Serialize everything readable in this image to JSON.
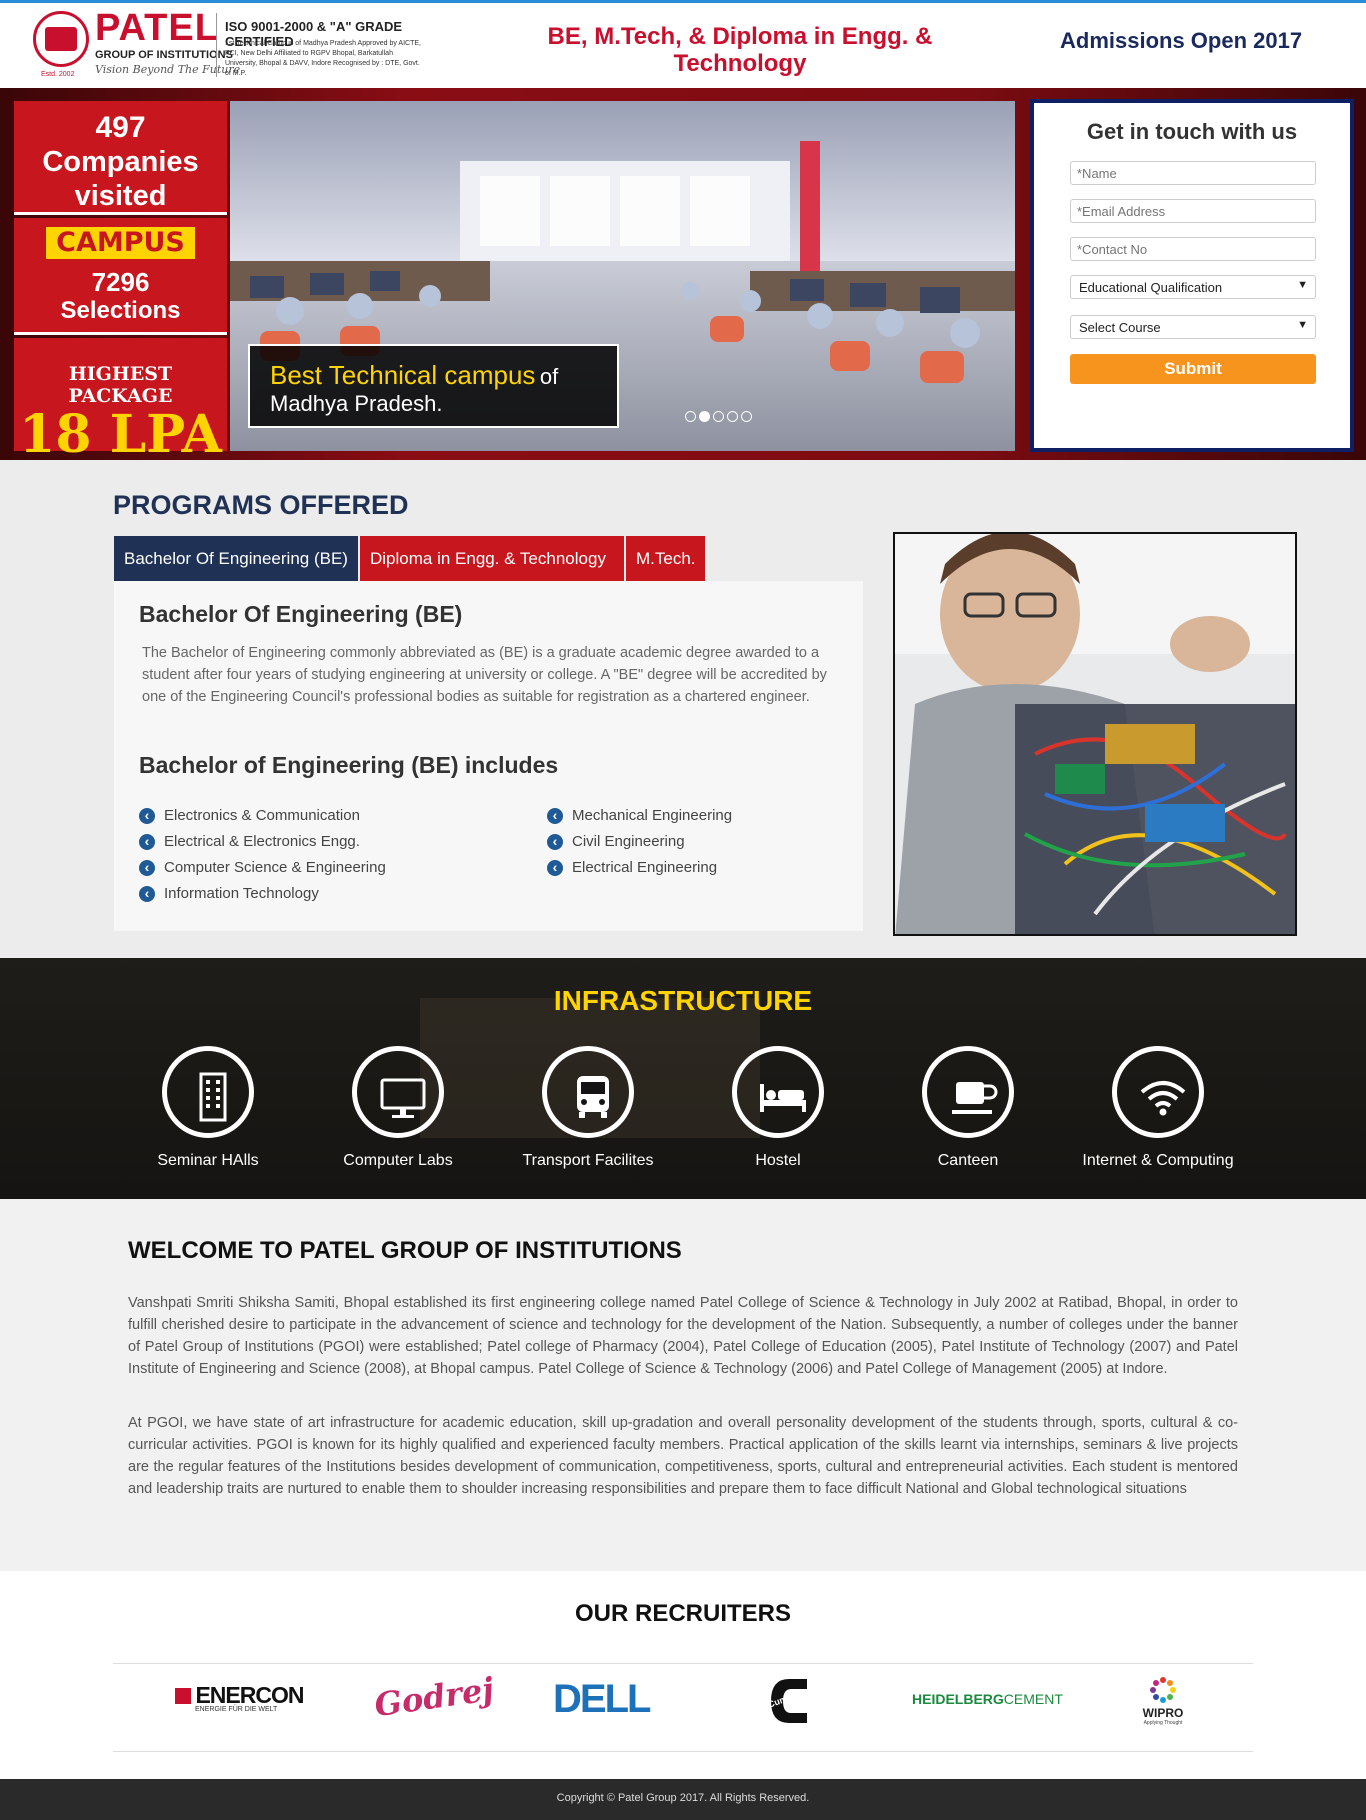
{
  "header": {
    "logo_name": "PATEL",
    "logo_group": "GROUP OF INSTITUTIONS",
    "logo_tagline": "Vision Beyond The Future",
    "logo_estd": "Estd. 2002",
    "iso_title": "ISO 9001-2000 & \"A\" GRADE CERTIFIED",
    "iso_text": "1st Technical Campus of Madhya Pradesh Approved by AICTE, PCI, New Delhi Affiliated to RGPV Bhopal, Barkatullah University, Bhopal & DAVV, Indore Recognised by : DTE, Govt. of M.P.",
    "programs_heading": "BE, M.Tech, & Diploma in Engg. & Technology",
    "admission": "Admissions Open 2017"
  },
  "hero": {
    "stat1_number": "497",
    "stat1_label_a": "Companies",
    "stat1_label_b": "visited",
    "campus_badge": "CAMPUS",
    "stat2_number": "7296",
    "stat2_label": "Selections",
    "stat3_label": "HIGHEST PACKAGE",
    "stat3_value": "18 LPA",
    "caption_a": "Best Technical campus",
    "caption_of": "of",
    "caption_b": "Madhya Pradesh.",
    "slide_count": 5,
    "active_slide": 2
  },
  "form": {
    "title": "Get in touch with us",
    "name_placeholder": "*Name",
    "email_placeholder": "*Email Address",
    "contact_placeholder": "*Contact No",
    "qualification_selected": "Educational Qualification",
    "course_selected": "Select Course",
    "submit_label": "Submit"
  },
  "programs": {
    "title": "PROGRAMS OFFERED",
    "tabs": [
      "Bachelor Of Engineering (BE)",
      "Diploma in Engg. & Technology",
      "M.Tech."
    ],
    "heading": "Bachelor Of Engineering (BE)",
    "description": "The Bachelor of Engineering commonly abbreviated as (BE) is a graduate academic degree awarded to a student after four years of studying engineering at university or college. A \"BE\" degree will be accredited by one of the Engineering Council's professional bodies as suitable for registration as a chartered engineer.",
    "includes_heading": "Bachelor of Engineering (BE) includes",
    "list_left": [
      "Electronics & Communication",
      "Electrical & Electronics Engg.",
      "Computer Science & Engineering",
      "Information Technology"
    ],
    "list_right": [
      "Mechanical Engineering",
      "Civil Engineering",
      "Electrical Engineering"
    ]
  },
  "infrastructure": {
    "title": "INFRASTRUCTURE",
    "items": [
      {
        "label": "Seminar HAlls",
        "icon": "building-icon"
      },
      {
        "label": "Computer Labs",
        "icon": "monitor-icon"
      },
      {
        "label": "Transport Facilites",
        "icon": "bus-icon"
      },
      {
        "label": "Hostel",
        "icon": "bed-icon"
      },
      {
        "label": "Canteen",
        "icon": "coffee-icon"
      },
      {
        "label": "Internet & Computing",
        "icon": "wifi-icon"
      }
    ]
  },
  "welcome": {
    "title": "WELCOME TO PATEL GROUP OF INSTITUTIONS",
    "p1": "Vanshpati Smriti Shiksha Samiti, Bhopal established its first engineering college named Patel College of Science & Technology in July 2002 at Ratibad, Bhopal, in order to fulfill cherished desire to participate in the advancement of science and technology for the development of the Nation. Subsequently, a number of colleges under the banner of Patel Group of Institutions (PGOI) were established; Patel college of Pharmacy (2004), Patel College of Education (2005), Patel Institute of Technology (2007) and Patel Institute of Engineering and Science (2008), at Bhopal campus. Patel College of Science & Technology (2006) and Patel College of Management (2005) at Indore.",
    "p2": "At PGOI, we have state of art infrastructure for academic education, skill up-gradation and overall personality development of the students through, sports, cultural & co-curricular activities. PGOI is known for its highly qualified and experienced faculty members. Practical application of the skills learnt via internships, seminars & live projects are the regular features of the Institutions besides development of communication, competitiveness, sports, cultural and entrepreneurial activities. Each student is mentored and leadership traits are nurtured to enable them to shoulder increasing responsibilities and prepare them to face difficult National and Global technological situations"
  },
  "recruiters": {
    "title": "OUR RECRUITERS",
    "logos": [
      "ENERCON",
      "ENERGIE FÜR DIE WELT",
      "Godrej",
      "DELL",
      "Cummins",
      "HEIDELBERG",
      "CEMENT",
      "WIPRO",
      "Applying Thought"
    ]
  },
  "footer": {
    "copyright": "Copyright © Patel Group 2017. All Rights Reserved."
  },
  "colors": {
    "brand_red": "#c8161e",
    "navy": "#1f3155",
    "yellow": "#ffd400",
    "orange": "#f7941d"
  }
}
